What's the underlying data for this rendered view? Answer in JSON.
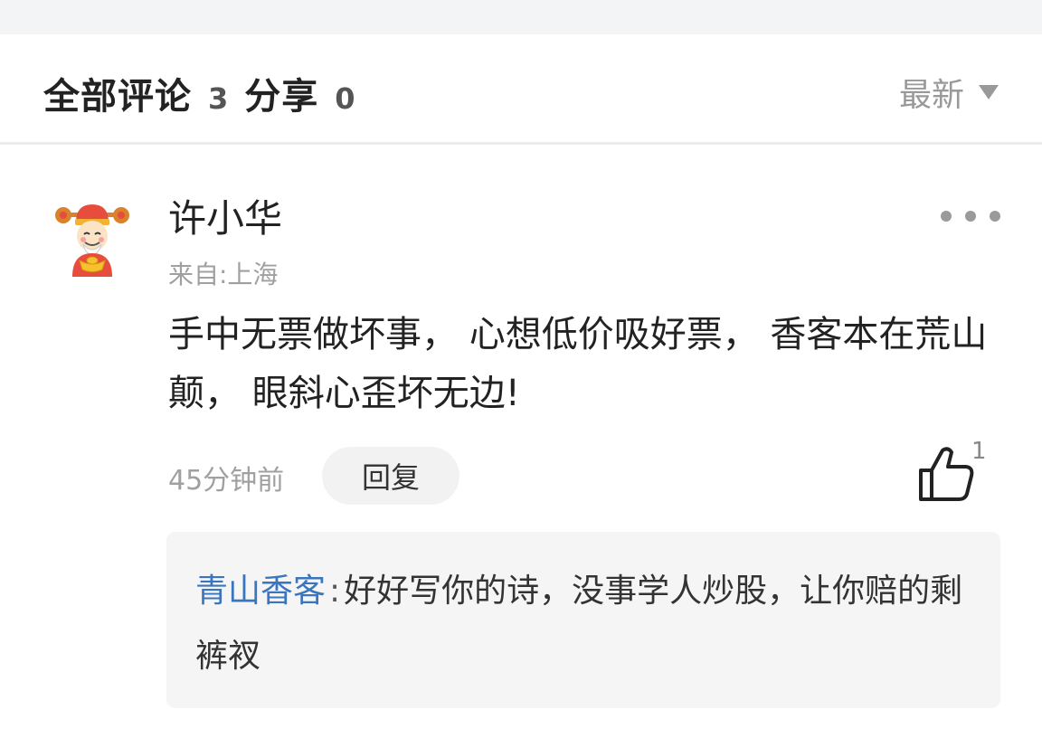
{
  "header": {
    "comments_label": "全部评论",
    "comments_count": "3",
    "share_label": "分享",
    "share_count": "0",
    "sort_label": "最新",
    "sort_icon": "triangle-down-icon"
  },
  "comment": {
    "avatar_icon": "caishen-avatar",
    "author": "许小华",
    "location": "来自:上海",
    "text": "手中无票做坏事， 心想低价吸好票， 香客本在荒山颠， 眼斜心歪坏无边!",
    "time": "45分钟前",
    "reply_label": "回复",
    "like_icon": "thumbs-up-icon",
    "like_count": "1",
    "more_icon": "more-dots-icon",
    "replies": [
      {
        "author": "青山香客",
        "separator": ":",
        "text": "好好写你的诗，没事学人炒股，让你赔的剩裤衩"
      }
    ]
  }
}
